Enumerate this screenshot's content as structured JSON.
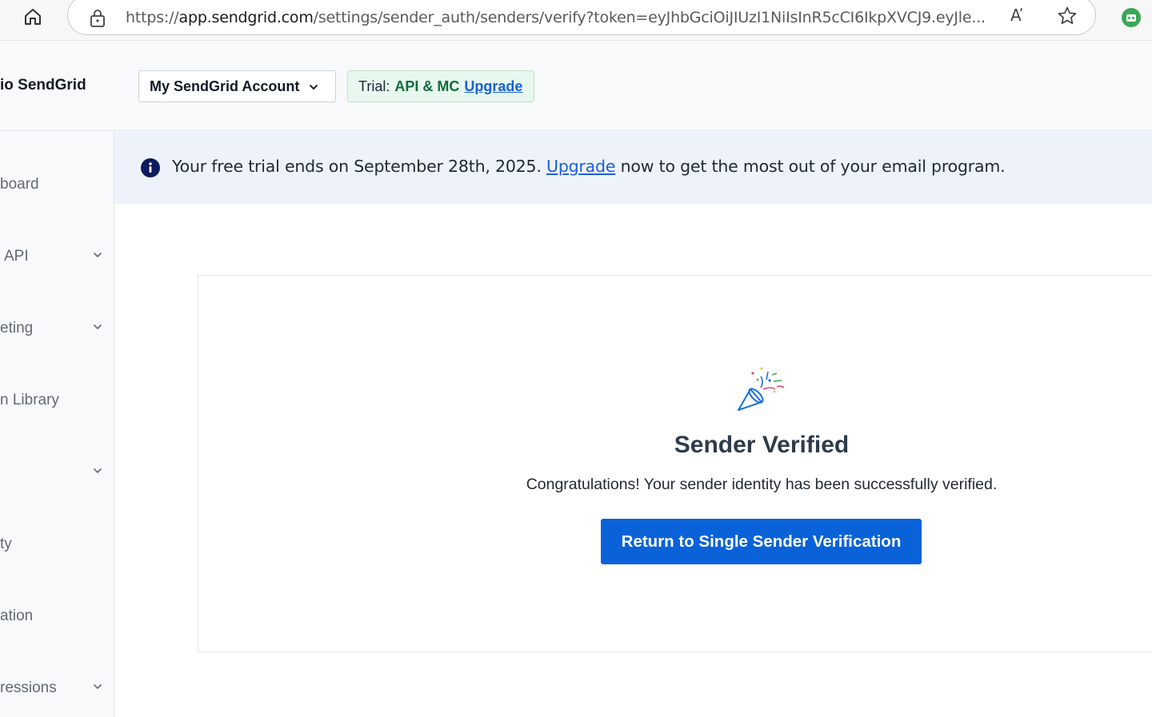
{
  "browser": {
    "url_prefix": "https://",
    "url_host": "app.sendgrid.com",
    "url_path": "/settings/sender_auth/senders/verify?token=eyJhbGciOiJIUzI1NiIsInR5cCI6IkpXVCJ9.eyJle...",
    "read_aloud_glyph": "A̕"
  },
  "header": {
    "brand": "io SendGrid",
    "account_label": "My SendGrid Account",
    "trial_label": "Trial:",
    "trial_plan": "API & MC",
    "trial_upgrade": "Upgrade"
  },
  "sidebar": {
    "items": [
      {
        "label": "board",
        "has_chevron": false
      },
      {
        "label": "API",
        "has_chevron": true
      },
      {
        "label": "eting",
        "has_chevron": true
      },
      {
        "label": "n Library",
        "has_chevron": false
      },
      {
        "label": "",
        "has_chevron": true
      },
      {
        "label": "ty",
        "has_chevron": false
      },
      {
        "label": "ation",
        "has_chevron": false
      },
      {
        "label": "ressions",
        "has_chevron": true
      }
    ]
  },
  "banner": {
    "text_before": "Your free trial ends on September 28th, 2025.",
    "link": "Upgrade",
    "text_after": "now to get the most out of your email program."
  },
  "card": {
    "title": "Sender Verified",
    "message": "Congratulations! Your sender identity has been successfully verified.",
    "button": "Return to Single Sender Verification"
  },
  "colors": {
    "primary": "#0a62d9",
    "link": "#1a5fd9",
    "trial_green": "#136b3a",
    "banner_bg": "#eef3fb"
  }
}
